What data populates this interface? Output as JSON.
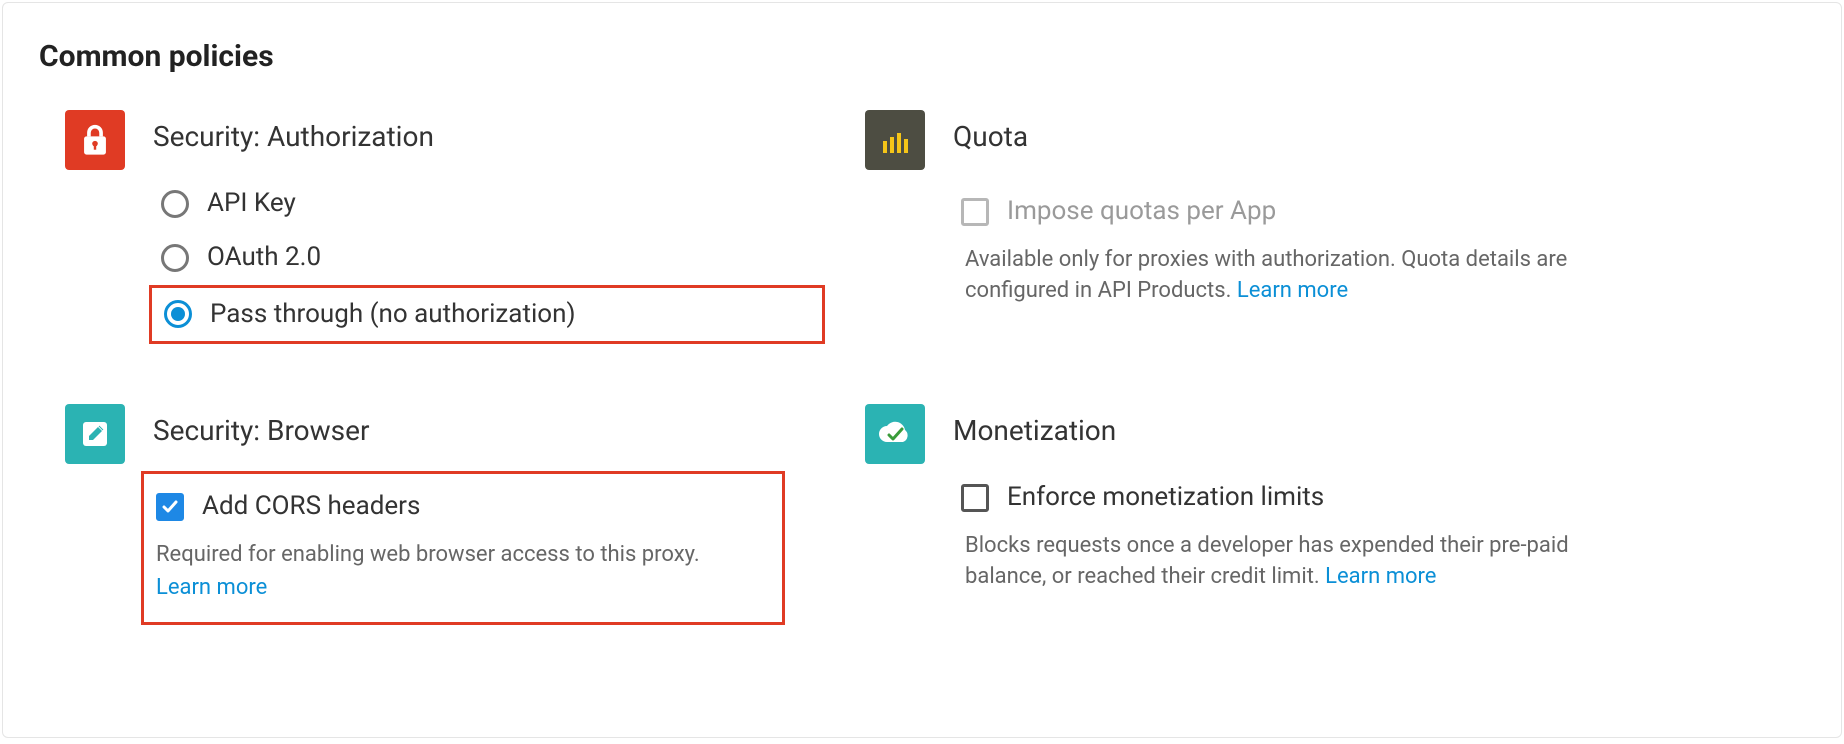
{
  "title": "Common policies",
  "sections": {
    "security_auth": {
      "title": "Security: Authorization",
      "options": {
        "api_key": "API Key",
        "oauth": "OAuth 2.0",
        "passthrough": "Pass through (no authorization)"
      }
    },
    "quota": {
      "title": "Quota",
      "checkbox_label": "Impose quotas per App",
      "helper": "Available only for proxies with authorization. Quota details are configured in API Products.",
      "learn_more": "Learn more"
    },
    "security_browser": {
      "title": "Security: Browser",
      "checkbox_label": "Add CORS headers",
      "helper": "Required for enabling web browser access to this proxy.",
      "learn_more": "Learn more"
    },
    "monetization": {
      "title": "Monetization",
      "checkbox_label": "Enforce monetization limits",
      "helper": "Blocks requests once a developer has expended their pre-paid balance, or reached their credit limit.",
      "learn_more": "Learn more"
    }
  }
}
